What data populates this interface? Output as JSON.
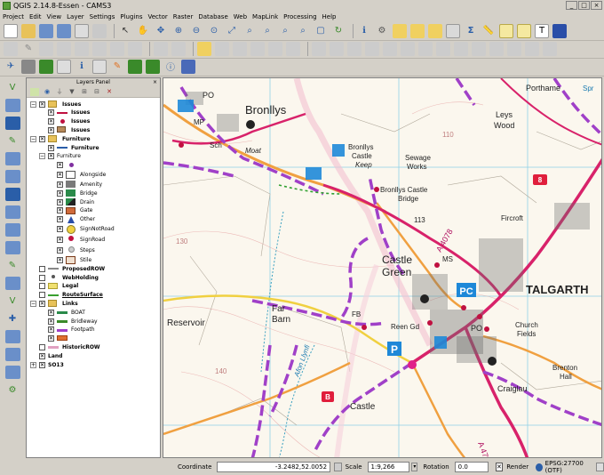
{
  "window": {
    "title": "QGIS 2.14.8-Essen - CAMS3",
    "buttons": [
      "_",
      "□",
      "×"
    ]
  },
  "menu": [
    "Project",
    "Edit",
    "View",
    "Layer",
    "Settings",
    "Plugins",
    "Vector",
    "Raster",
    "Database",
    "Web",
    "MapLink",
    "Processing",
    "Help"
  ],
  "layers_panel": {
    "title": "Layers Panel",
    "close": "×",
    "layers": [
      {
        "label": "Issues",
        "indent": 0,
        "expand": "−",
        "checked": true,
        "sym": "group"
      },
      {
        "label": "Issues",
        "indent": 1,
        "checked": true,
        "sym": "redline"
      },
      {
        "label": "Issues",
        "indent": 1,
        "checked": true,
        "sym": "reddot"
      },
      {
        "label": "Issues",
        "indent": 1,
        "checked": true,
        "sym": "brownpoly"
      },
      {
        "label": "Furniture",
        "indent": 0,
        "expand": "−",
        "checked": true,
        "sym": "group"
      },
      {
        "label": "Furniture",
        "indent": 1,
        "checked": true,
        "sym": "blueline"
      },
      {
        "label": "Furniture",
        "indent": 1,
        "expand": "−",
        "checked": true,
        "sym": "none"
      },
      {
        "label": "",
        "indent": 2,
        "checked": true,
        "sym": "purpledot"
      },
      {
        "label": "Alongside",
        "indent": 2,
        "checked": true,
        "sym": "alongside",
        "tall": true
      },
      {
        "label": "Amenity",
        "indent": 2,
        "checked": true,
        "sym": "amenity"
      },
      {
        "label": "Bridge",
        "indent": 2,
        "checked": true,
        "sym": "bridge"
      },
      {
        "label": "Drain",
        "indent": 2,
        "checked": true,
        "sym": "drain"
      },
      {
        "label": "Gate",
        "indent": 2,
        "checked": true,
        "sym": "gate"
      },
      {
        "label": "Other",
        "indent": 2,
        "checked": true,
        "sym": "other"
      },
      {
        "label": "SignNotRoad",
        "indent": 2,
        "checked": true,
        "sym": "signnotroad",
        "tall": true
      },
      {
        "label": "SignRoad",
        "indent": 2,
        "checked": true,
        "sym": "signroad",
        "tall": true
      },
      {
        "label": "Steps",
        "indent": 2,
        "checked": true,
        "sym": "steps",
        "tall": true
      },
      {
        "label": "Stile",
        "indent": 2,
        "checked": true,
        "sym": "stile"
      },
      {
        "label": "ProposedROW",
        "indent": 0,
        "checked": false,
        "sym": "greyline"
      },
      {
        "label": "WebHolding",
        "indent": 0,
        "checked": false,
        "sym": "greydot"
      },
      {
        "label": "Legal",
        "indent": 0,
        "checked": false,
        "sym": "yellowpoly"
      },
      {
        "label": "RouteSurface",
        "indent": 0,
        "checked": false,
        "sym": "greenline",
        "underline": true
      },
      {
        "label": "Links",
        "indent": 0,
        "expand": "−",
        "checked": true,
        "sym": "group"
      },
      {
        "label": "BOAT",
        "indent": 1,
        "checked": true,
        "sym": "boat"
      },
      {
        "label": "Bridleway",
        "indent": 1,
        "checked": true,
        "sym": "bridleway"
      },
      {
        "label": "Footpath",
        "indent": 1,
        "checked": true,
        "sym": "footpath"
      },
      {
        "label": "",
        "indent": 1,
        "checked": true,
        "sym": "orangeline"
      },
      {
        "label": "HistoricROW",
        "indent": 0,
        "checked": false,
        "sym": "pinkline"
      },
      {
        "label": "Land",
        "indent": 0,
        "checked": true,
        "sym": "none"
      },
      {
        "label": "SO13",
        "indent": 0,
        "expand": "+",
        "checked": true,
        "sym": "none"
      }
    ]
  },
  "map_labels": {
    "bronllys": "Bronllys",
    "moat": "Moat",
    "bronllys_castle": "Bronllys",
    "castle": "Castle",
    "keep": "Keep",
    "sewage": "Sewage",
    "works": "Works",
    "bridge_label": "Bronllys Castle",
    "bridge_label2": "Bridge",
    "leys": "Leys",
    "wood": "Wood",
    "portham": "Porthame",
    "fircroft": "Fircroft",
    "castle_green1": "Castle",
    "castle_green2": "Green",
    "talgarth": "TALGARTH",
    "far_barn1": "Far",
    "far_barn2": "Barn",
    "reservoir": "Reservoir",
    "reen": "Reen Gd",
    "church": "Church",
    "fields": "Fields",
    "brenton": "Brenton",
    "hall": "Hall",
    "craiglau": "Craiglau",
    "castle2": "Castle",
    "afon": "Afon Llynfi",
    "a4078": "A 4078",
    "a479": "A 479",
    "road_b": "B",
    "spr": "Spr",
    "po1": "PO",
    "po2": "PO",
    "mp": "MP",
    "sch": "Sch",
    "ms": "MS",
    "fb": "FB",
    "h113": "113",
    "h110": "110",
    "h140": "140",
    "h130": "130",
    "road8": "8",
    "parking": "P",
    "pc": "PC"
  },
  "status": {
    "coordinate_label": "Coordinate",
    "coordinate_value": "-3.2482,52.0052",
    "scale_label": "Scale",
    "scale_value": "1:9,266",
    "rotation_label": "Rotation",
    "rotation_value": "0.0",
    "render_label": "Render",
    "crs": "EPSG:27700 (OTF)"
  }
}
